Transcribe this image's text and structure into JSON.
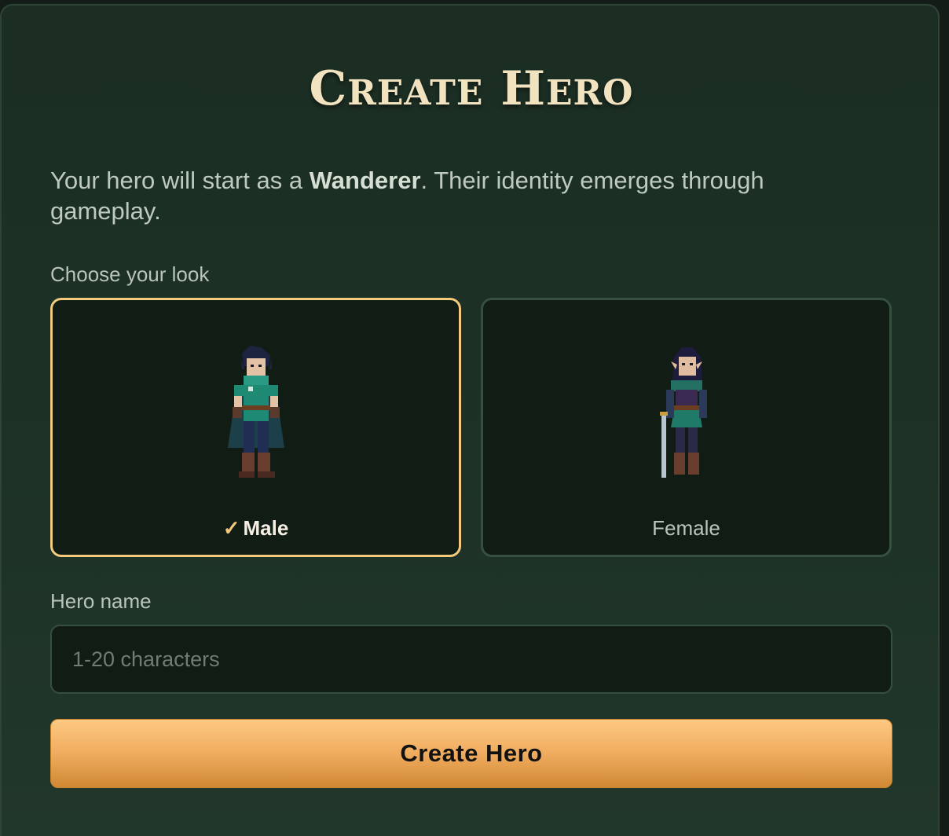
{
  "header": {
    "title_first": "C",
    "title_first_rest": "REATE",
    "title_second": "H",
    "title_second_rest": "ERO"
  },
  "intro": {
    "before": "Your hero will start as a ",
    "class_name": "Wanderer",
    "after": ". Their identity emerges through gameplay."
  },
  "look": {
    "label": "Choose your look",
    "options": [
      {
        "label": "Male",
        "selected": true,
        "icon": "check-icon"
      },
      {
        "label": "Female",
        "selected": false
      }
    ],
    "check_glyph": "✓"
  },
  "name": {
    "label": "Hero name",
    "placeholder": "1-20 characters",
    "value": ""
  },
  "submit": {
    "label": "Create Hero"
  },
  "colors": {
    "accent": "#f3c97d",
    "panel": "#1d3126",
    "button": "#f0ac5f"
  }
}
